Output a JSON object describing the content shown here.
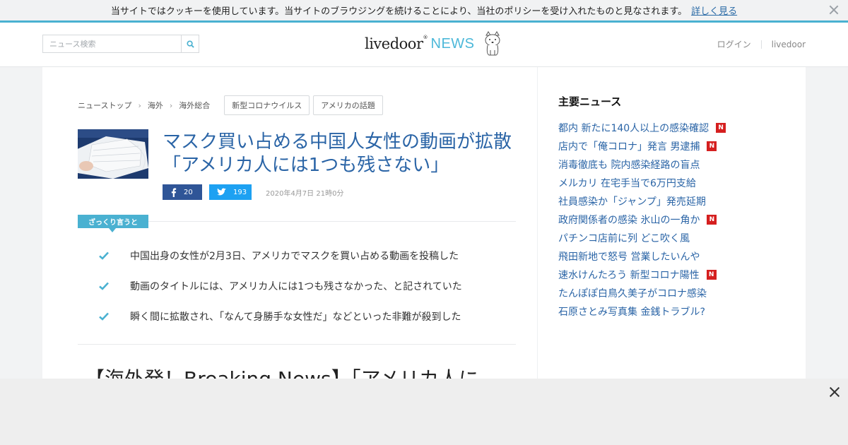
{
  "cookie_bar": {
    "text": "当サイトではクッキーを使用しています。当サイトのブラウジングを続けることにより、当社のポリシーを受け入れたものと見なされます。",
    "more_link": "詳しく見る"
  },
  "header": {
    "search_placeholder": "ニュース検索",
    "logo_brand": "livedoor",
    "logo_news": "NEWS",
    "login_label": "ログイン",
    "livedoor_label": "livedoor"
  },
  "breadcrumb": {
    "items": [
      "ニューストップ",
      "海外",
      "海外総合"
    ],
    "tags": [
      "新型コロナウイルス",
      "アメリカの話題"
    ]
  },
  "article": {
    "headline": "マスク買い占める中国人女性の動画が拡散「アメリカ人には1つも残さない」",
    "facebook_count": "20",
    "twitter_count": "193",
    "date": "2020年4月7日 21時0分",
    "summary_label": "ざっくり言うと",
    "summary": [
      "中国出身の女性が2月3日、アメリカでマスクを買い占める動画を投稿した",
      "動画のタイトルには、アメリカ人には1つも残さなかった、と記されていた",
      "瞬く間に拡散され、「なんて身勝手な女性だ」などといった非難が殺到した"
    ],
    "body_heading": "【海外発！Breaking News】「アメリカ人に"
  },
  "sidebar": {
    "title": "主要ニュース",
    "news": [
      {
        "title": "都内 新たに140人以上の感染確認",
        "new": true
      },
      {
        "title": "店内で「俺コロナ」発言 男逮捕",
        "new": true
      },
      {
        "title": "消毒徹底も 院内感染経路の盲点",
        "new": false
      },
      {
        "title": "メルカリ 在宅手当で6万円支給",
        "new": false
      },
      {
        "title": "社員感染か「ジャンプ」発売延期",
        "new": false
      },
      {
        "title": "政府関係者の感染 氷山の一角か",
        "new": true
      },
      {
        "title": "パチンコ店前に列 どこ吹く風",
        "new": false
      },
      {
        "title": "飛田新地で怒号 営業したいんや",
        "new": false
      },
      {
        "title": "速水けんたろう 新型コロナ陽性",
        "new": true
      },
      {
        "title": "たんぽぽ白鳥久美子がコロナ感染",
        "new": false
      },
      {
        "title": "石原さとみ写真集 金銭トラブル?",
        "new": false
      }
    ],
    "new_badge_label": "N"
  },
  "colors": {
    "accent": "#4ab1d1",
    "link": "#2a64a6",
    "facebook": "#2f5597",
    "twitter": "#1da1f2",
    "new_badge": "#d51f1f"
  },
  "icons": {
    "search": "search-icon",
    "facebook": "facebook-icon",
    "twitter": "twitter-icon",
    "check": "check-icon",
    "close": "close-icon",
    "mascot": "dog-mascot-icon"
  }
}
